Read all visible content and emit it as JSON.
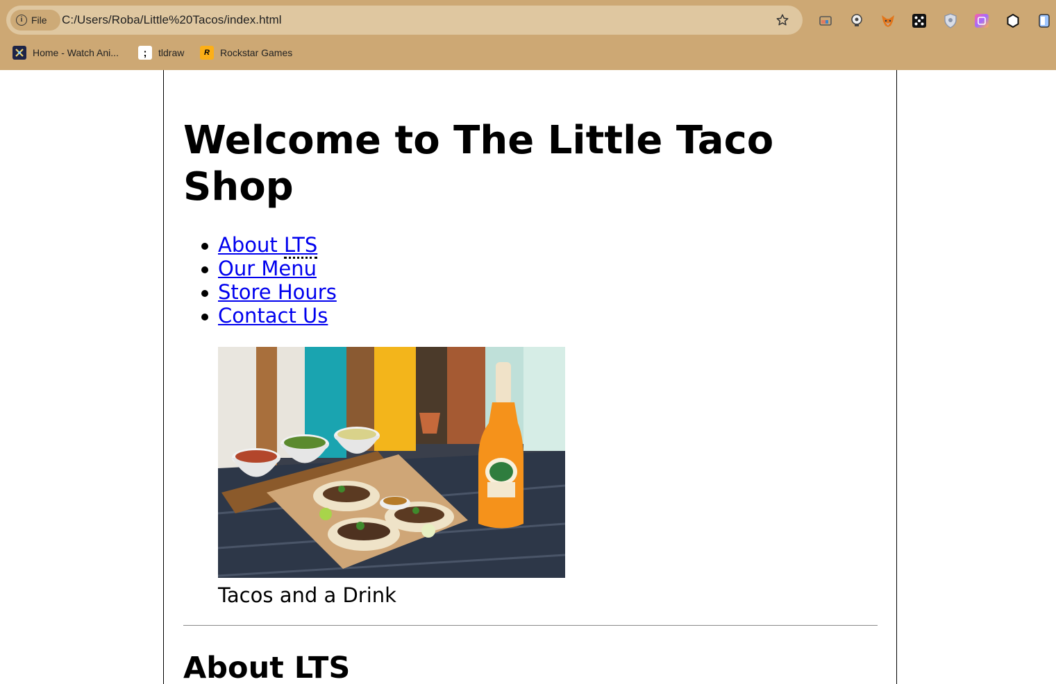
{
  "browser": {
    "site_chip_label": "File",
    "url": "C:/Users/Roba/Little%20Tacos/index.html",
    "extensions": [
      "cast-icon",
      "bulb-icon",
      "fox-icon",
      "dice-icon",
      "shield-icon",
      "gradient-app-icon",
      "hexagon-icon",
      "sidepanel-icon"
    ],
    "bookmarks": [
      {
        "label": "Home - Watch Ani...",
        "icon": "anime-site-icon"
      },
      {
        "label": "tldraw",
        "icon": "tldraw-icon"
      },
      {
        "label": "Rockstar Games",
        "icon": "rockstar-icon"
      }
    ]
  },
  "page": {
    "title": "Welcome to The Little Taco Shop",
    "nav": [
      {
        "text_before": "About ",
        "abbr": "LTS"
      },
      {
        "text_before": "Our Menu",
        "abbr": ""
      },
      {
        "text_before": "Store Hours",
        "abbr": ""
      },
      {
        "text_before": "Contact Us",
        "abbr": ""
      }
    ],
    "figure_caption": "Tacos and a Drink",
    "section_heading_before": "About ",
    "section_heading_abbr": "LTS"
  },
  "colors": {
    "chrome": "#cda874",
    "omnibox": "#dfc7a0",
    "link": "#0000ee"
  }
}
